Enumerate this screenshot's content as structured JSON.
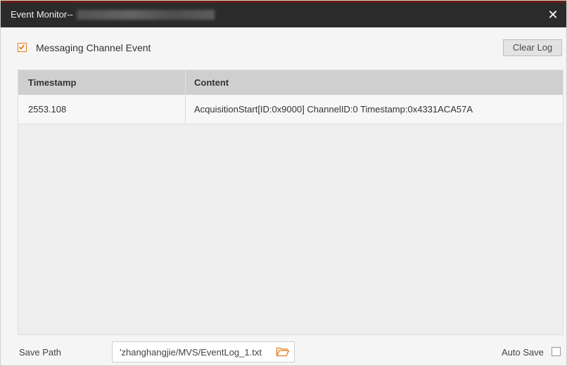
{
  "window": {
    "title": "Event Monitor--",
    "close_glyph": "✕",
    "accent_color": "#e07a1c"
  },
  "options": {
    "messaging_channel_event": {
      "label": "Messaging Channel Event",
      "checked": true
    },
    "clear_log_label": "Clear Log"
  },
  "table": {
    "columns": [
      "Timestamp",
      "Content"
    ],
    "rows": [
      {
        "timestamp": "2553.108",
        "content": "AcquisitionStart[ID:0x9000] ChannelID:0 Timestamp:0x4331ACA57A"
      }
    ]
  },
  "footer": {
    "save_path_label": "Save Path",
    "save_path_value": "'zhanghangjie/MVS/EventLog_1.txt",
    "folder_icon": "folder-open-icon",
    "auto_save_label": "Auto Save",
    "auto_save_checked": false
  }
}
